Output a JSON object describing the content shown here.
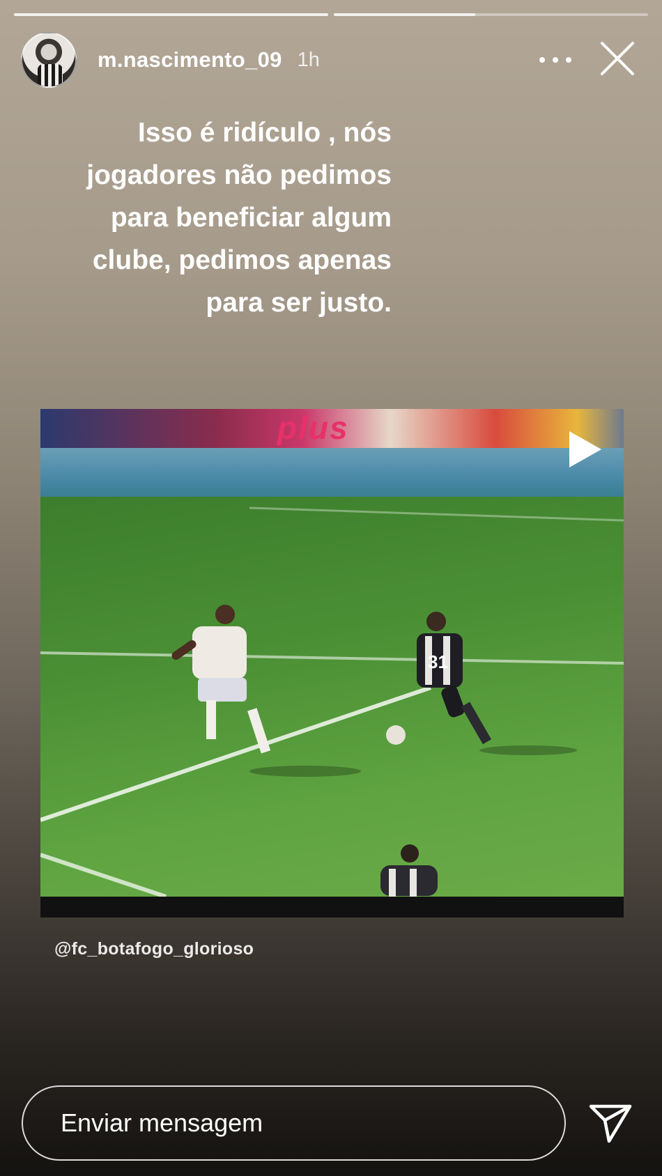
{
  "story": {
    "progress": [
      1.0,
      0.45
    ],
    "username": "m.nascimento_09",
    "time": "1h",
    "caption_lines": [
      "Isso é ridículo , nós",
      "jogadores não pedimos",
      "para beneficiar algum",
      "clube, pedimos apenas",
      "para ser justo."
    ],
    "video": {
      "banner_text": "plus",
      "jersey_number": "31"
    },
    "attribution": "@fc_botafogo_glorioso"
  },
  "reply": {
    "placeholder": "Enviar mensagem"
  },
  "icons": {
    "more": "more-options-icon",
    "close": "close-icon",
    "play": "play-icon",
    "send": "send-icon"
  }
}
